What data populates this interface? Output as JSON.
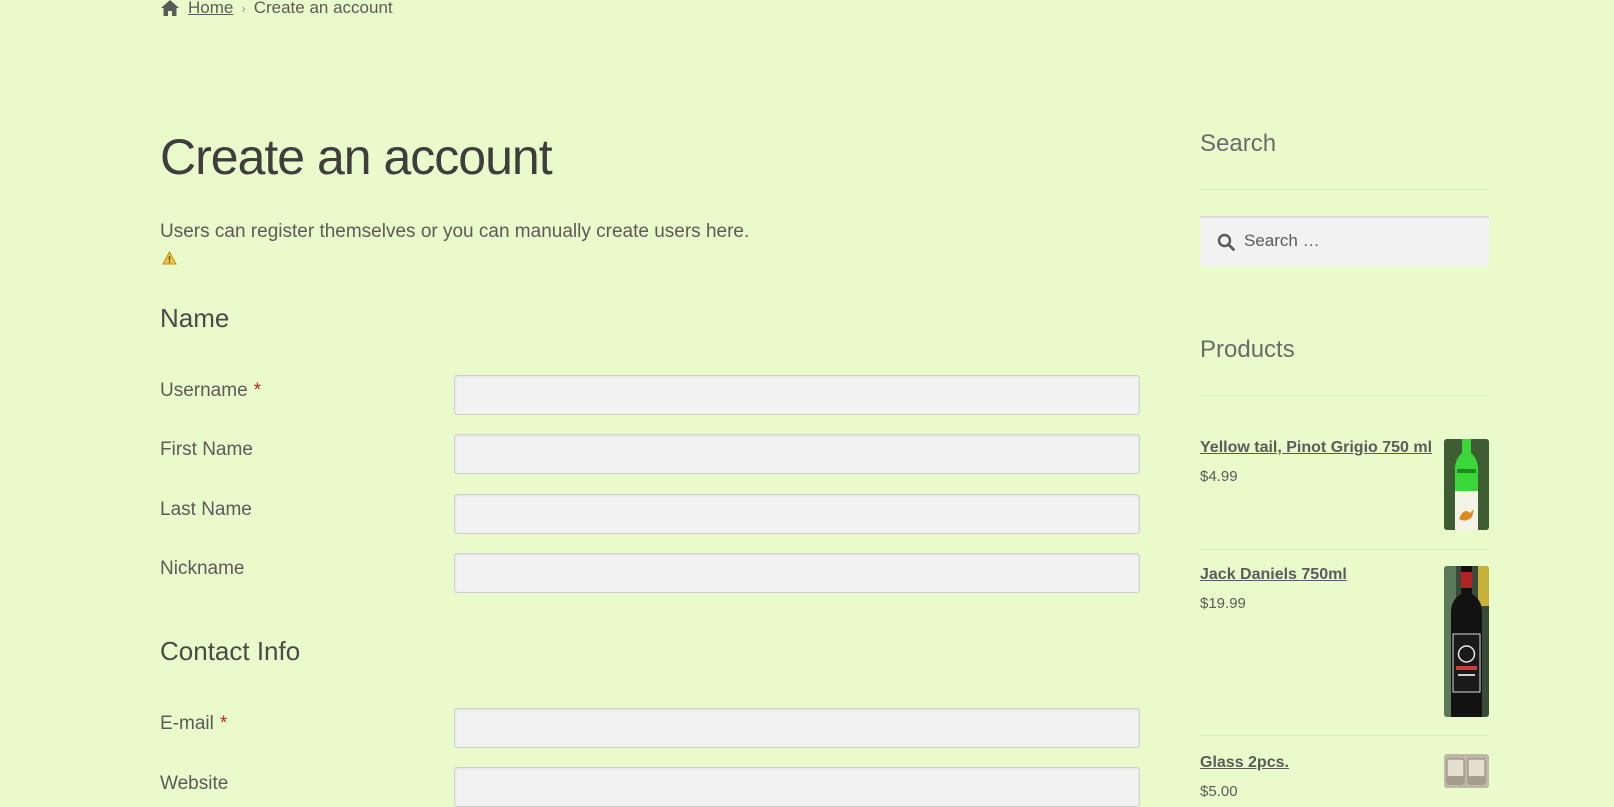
{
  "breadcrumb": {
    "home": "Home",
    "separator": "›",
    "current": "Create an account"
  },
  "page": {
    "title": "Create an account",
    "intro": "Users can register themselves or you can manually create users here."
  },
  "form": {
    "sections": {
      "name": "Name",
      "contact": "Contact Info"
    },
    "required_marker": "*",
    "fields": {
      "username": {
        "label": "Username",
        "value": ""
      },
      "first_name": {
        "label": "First Name",
        "value": ""
      },
      "last_name": {
        "label": "Last Name",
        "value": ""
      },
      "nickname": {
        "label": "Nickname",
        "value": ""
      },
      "email": {
        "label": "E-mail",
        "value": ""
      },
      "website": {
        "label": "Website",
        "value": ""
      }
    }
  },
  "sidebar": {
    "search": {
      "title": "Search",
      "placeholder": "Search …"
    },
    "products": {
      "title": "Products",
      "items": [
        {
          "name": "Yellow tail, Pinot Grigio 750 ml",
          "price": "$4.99"
        },
        {
          "name": "Jack Daniels 750ml",
          "price": "$19.99"
        },
        {
          "name": "Glass 2pcs.",
          "price": "$5.00"
        }
      ]
    }
  },
  "colors": {
    "background": "#e9fbca",
    "text": "#5b5b5b",
    "required": "#d11e1e",
    "input_bg": "#f2f2f2"
  }
}
